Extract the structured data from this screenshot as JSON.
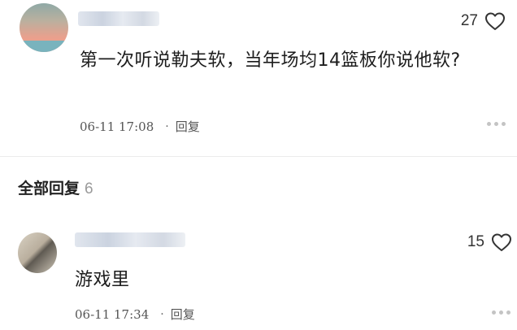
{
  "comments": [
    {
      "likes": "27",
      "text": "第一次听说勒夫软，当年场均14篮板你说他软?",
      "date": "06-11 17:08",
      "separator": "·",
      "reply_label": "回复"
    },
    {
      "likes": "15",
      "text": "游戏里",
      "date": "06-11 17:34",
      "separator": "·",
      "reply_label": "回复"
    }
  ],
  "replies_section": {
    "title": "全部回复",
    "count": "6"
  },
  "icons": {
    "like": "heart-outline-icon",
    "more": "more-dots-icon"
  },
  "colors": {
    "text": "#1d1d1d",
    "meta": "#555555",
    "divider": "#ececec",
    "count_gray": "#9a9a9a"
  }
}
